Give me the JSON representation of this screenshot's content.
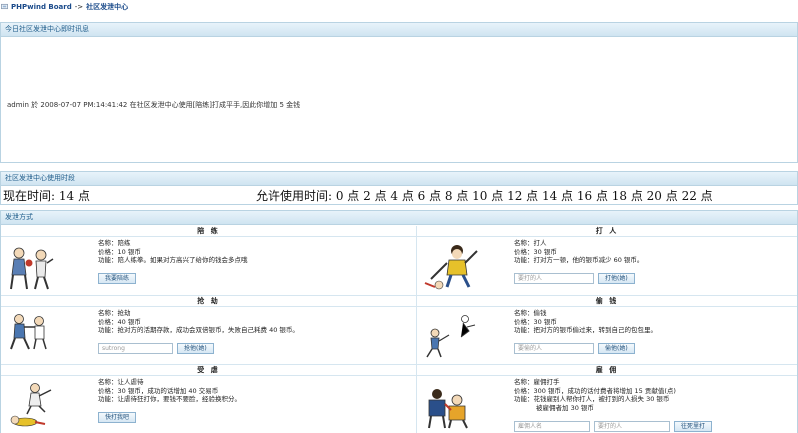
{
  "breadcrumb": {
    "root": "PHPwind Board",
    "sep": "->",
    "current": "社区发泄中心"
  },
  "panel_news": {
    "title": "今日社区发泄中心即时讯息",
    "message": "admin 於 2008-07-07 PM:14:41:42 在社区发泄中心使用[陪练]打成平手,因此你增加 5 金钱"
  },
  "panel_time": {
    "title": "社区发泄中心使用时段",
    "now": "现在时间: 14 点",
    "allowed": "允许使用时间: 0 点 2 点 4 点 6 点 8 点 10 点 12 点 14 点 16 点 18 点 20 点 22 点"
  },
  "panel_modes": {
    "title": "发泄方式",
    "items": [
      {
        "title": "陪 练",
        "name": "名称：陪练",
        "price": "价格：10 银币",
        "func": "功能：陪人练拳。如果对方高兴了给你的钱会多点哦",
        "button": "我要陪练"
      },
      {
        "title": "打 人",
        "name": "名称：打人",
        "price": "价格：30 银币",
        "func": "功能：打对方一顿，他的银币减少 60 银币。",
        "placeholder": "要打的人",
        "button": "打他(她)"
      },
      {
        "title": "抢 劫",
        "name": "名称：抢劫",
        "price": "价格：40 银币",
        "func": "功能：抢对方的活期存款，成功会双倍银币，失败自己耗费 40 银币。",
        "input_value": "sutrong",
        "button": "抢他(她)"
      },
      {
        "title": "偷 钱",
        "name": "名称：偷钱",
        "price": "价格：30 银币",
        "func": "功能：把对方的银币偷过来，转到自己的包包里。",
        "placeholder": "要偷的人",
        "button": "偷他(她)"
      },
      {
        "title": "受 虐",
        "name": "名称：让人虐待",
        "price": "价格：30 银币，成功的话增加 40 交易币",
        "func": "功能：让虐待狂打你，要钱不要脸，经验换积分。",
        "button": "快打我吧"
      },
      {
        "title": "雇 佣",
        "name": "名称：雇佣打手",
        "price": "价格：300 银币，成功的话付费者将增加 15 贡献值(点)",
        "func": "功能：花钱雇别人帮你打人，被打到的人损失 30 银币",
        "func2": "被雇佣者加 30 银币",
        "placeholder": "雇佣人名",
        "placeholder2": "要打的人",
        "button": "往死里打"
      }
    ]
  }
}
